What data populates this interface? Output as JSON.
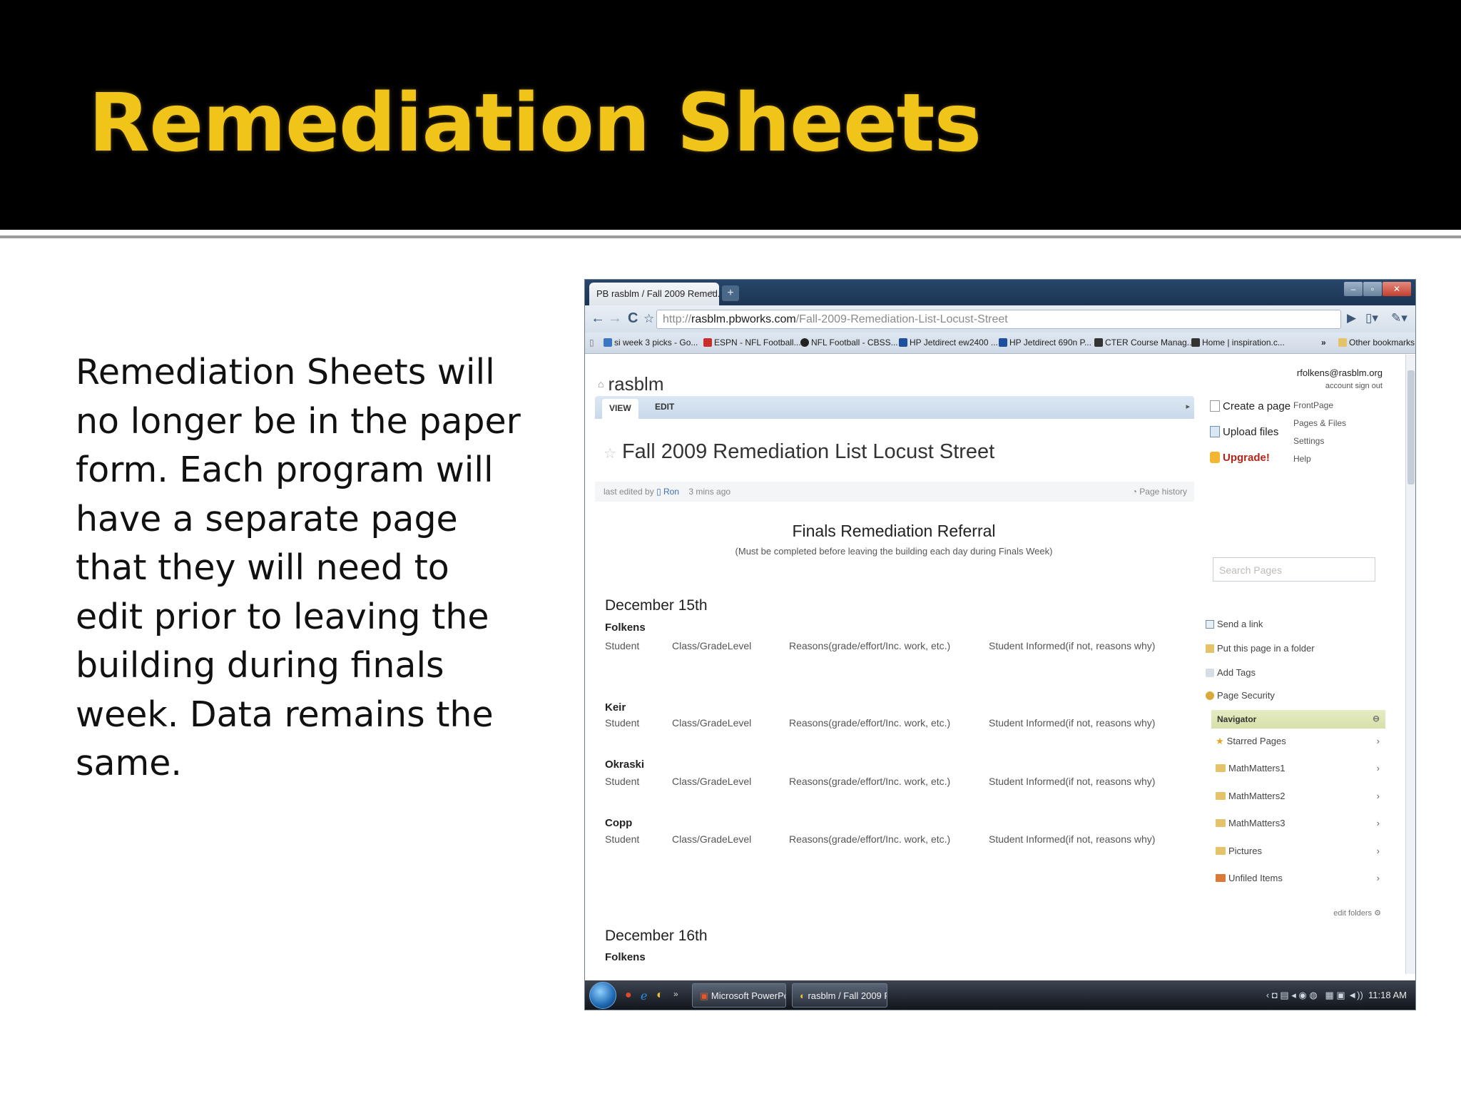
{
  "slide": {
    "title": "Remediation Sheets",
    "body": "Remediation Sheets will no longer be in the paper form. Each program will have a separate page that they will need to edit prior to leaving the building during finals week. Data remains the same."
  },
  "browser": {
    "tab_title": "PB rasblm / Fall 2009 Remed...",
    "tab_close": "×",
    "new_tab": "+",
    "url_prefix": "http://",
    "url_host": "rasblm.pbworks.com",
    "url_path": "/Fall-2009-Remediation-List-Locust-Street",
    "nav": {
      "back": "←",
      "forward": "→",
      "reload": "C",
      "bookmark_star": "☆"
    },
    "bookmarks": [
      {
        "label": "si week 3 picks - Go...",
        "color": "#3b78c4"
      },
      {
        "label": "ESPN - NFL Football...",
        "color": "#c9302c"
      },
      {
        "label": "NFL Football - CBSS...",
        "color": "#222222"
      },
      {
        "label": "HP Jetdirect ew2400 ...",
        "color": "#1d4f9c"
      },
      {
        "label": "HP Jetdirect 690n P...",
        "color": "#1d4f9c"
      },
      {
        "label": "CTER Course Manag...",
        "color": "#333333"
      },
      {
        "label": "Home | inspiration.c...",
        "color": "#333333"
      }
    ],
    "bookmarks_more": "»",
    "other_bookmarks": "Other bookmarks"
  },
  "site": {
    "name": "rasblm",
    "account_email": "rfolkens@rasblm.org",
    "account_links": "account   sign out",
    "tabs": {
      "view": "VIEW",
      "edit": "EDIT"
    },
    "page_title": "Fall 2009 Remediation List Locust Street",
    "edited_by": "last edited by",
    "editor": "Ron",
    "edited_when": "3 mins ago",
    "page_history": "Page history"
  },
  "document": {
    "heading": "Finals Remediation Referral",
    "subheading": "(Must be completed before leaving the building each day during Finals Week)",
    "columns": [
      "Student",
      "Class/GradeLevel",
      "Reasons(grade/effort/Inc. work, etc.)",
      "Student Informed(if not, reasons why)"
    ],
    "days": [
      {
        "label": "December 15th",
        "teachers": [
          "Folkens",
          "Keir",
          "Okraski",
          "Copp"
        ]
      },
      {
        "label": "December 16th",
        "teachers": [
          "Folkens"
        ]
      }
    ]
  },
  "sidebar": {
    "actions": [
      "Create a page",
      "Upload files",
      "Upgrade!"
    ],
    "links": [
      "FrontPage",
      "Pages & Files",
      "Settings",
      "Help"
    ],
    "search_placeholder": "Search Pages",
    "utilities": [
      "Send a link",
      "Put this page in a folder",
      "Add Tags",
      "Page Security"
    ],
    "navigator": {
      "title": "Navigator",
      "items": [
        "Starred Pages",
        "MathMatters1",
        "MathMatters2",
        "MathMatters3",
        "Pictures",
        "Unfiled Items"
      ]
    },
    "edit_folders": "edit folders"
  },
  "taskbar": {
    "buttons": [
      "Microsoft PowerPoi...",
      "rasblm / Fall 2009 R..."
    ],
    "clock": "11:18 AM"
  },
  "colors": {
    "title_gold": "#f0c419",
    "header_black": "#000000",
    "link_blue": "#3d5877"
  }
}
